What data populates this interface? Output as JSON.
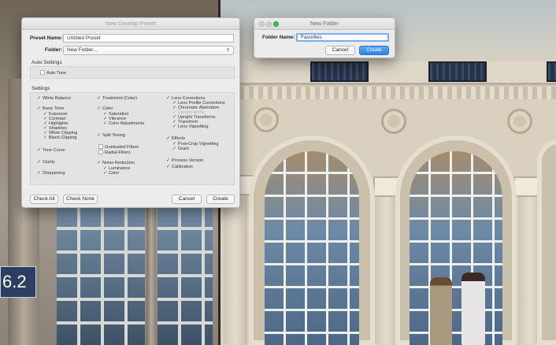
{
  "figure_label": "6.2",
  "develop_dialog": {
    "title": "New Develop Preset",
    "preset_name_label": "Preset Name:",
    "preset_name_value": "Untitled Preset",
    "folder_label": "Folder:",
    "folder_value": "New Folder...",
    "auto_settings_title": "Auto Settings",
    "auto_tone": "Auto Tone",
    "settings_title": "Settings",
    "col1": [
      {
        "label": "White Balance",
        "checked": true
      },
      {
        "label": "Basic Tone",
        "checked": true
      },
      {
        "label": "Exposure",
        "checked": true
      },
      {
        "label": "Contrast",
        "checked": true
      },
      {
        "label": "Highlights",
        "checked": true
      },
      {
        "label": "Shadows",
        "checked": true
      },
      {
        "label": "White Clipping",
        "checked": true
      },
      {
        "label": "Black Clipping",
        "checked": true
      },
      {
        "label": "Tone Curve",
        "checked": true
      },
      {
        "label": "Clarity",
        "checked": true
      },
      {
        "label": "Sharpening",
        "checked": true
      }
    ],
    "col2": [
      {
        "label": "Treatment (Color)",
        "checked": true
      },
      {
        "label": "Color",
        "checked": true
      },
      {
        "label": "Saturation",
        "checked": true
      },
      {
        "label": "Vibrance",
        "checked": true
      },
      {
        "label": "Color Adjustments",
        "checked": true
      },
      {
        "label": "Split Toning",
        "checked": true
      },
      {
        "label": "Graduated Filters",
        "checked": false
      },
      {
        "label": "Radial Filters",
        "checked": false
      },
      {
        "label": "Noise Reduction",
        "checked": true
      },
      {
        "label": "Luminance",
        "checked": true
      },
      {
        "label": "Color",
        "checked": true
      }
    ],
    "col3": [
      {
        "label": "Lens Corrections",
        "checked": true
      },
      {
        "label": "Lens Profile Corrections",
        "checked": true
      },
      {
        "label": "Chromatic Aberration",
        "checked": true
      },
      {
        "label": "Upright Mode",
        "checked": true
      },
      {
        "label": "Upright Transforms",
        "checked": true
      },
      {
        "label": "Transform",
        "checked": true
      },
      {
        "label": "Lens Vignetting",
        "checked": true
      },
      {
        "label": "Effects",
        "checked": true
      },
      {
        "label": "Post-Crop Vignetting",
        "checked": true
      },
      {
        "label": "Grain",
        "checked": true
      },
      {
        "label": "Process Version",
        "checked": true
      },
      {
        "label": "Calibration",
        "checked": true
      }
    ],
    "buttons": {
      "check_all": "Check All",
      "check_none": "Check None",
      "cancel": "Cancel",
      "create": "Create"
    }
  },
  "folder_dialog": {
    "title": "New Folder",
    "folder_name_label": "Folder Name:",
    "folder_name_value": "Favorites",
    "cancel": "Cancel",
    "create": "Create"
  },
  "colors": {
    "accent": "#2d83ea",
    "label_bg": "#2c3f63"
  }
}
